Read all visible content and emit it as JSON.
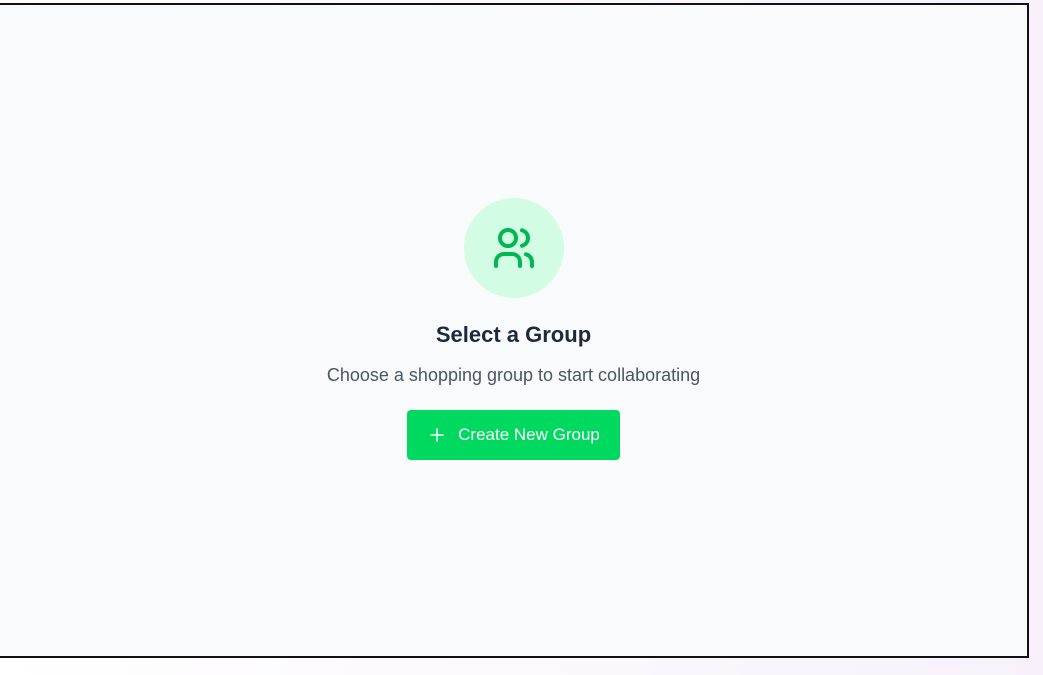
{
  "empty_state": {
    "icon": "users-icon",
    "title": "Select a Group",
    "subtitle": "Choose a shopping group to start collaborating",
    "create_button": {
      "label": "Create New Group",
      "icon": "plus-icon"
    }
  },
  "colors": {
    "accent": "#00d95f",
    "icon_green": "#00b84f",
    "icon_bg": "#d3fce5",
    "title": "#1e293b",
    "subtitle": "#4b5563",
    "panel_bg": "#f8fafc"
  }
}
